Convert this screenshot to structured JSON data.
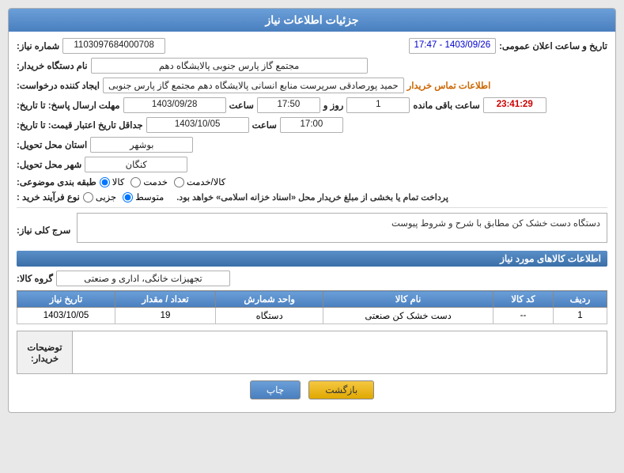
{
  "header": {
    "title": "جزئیات اطلاعات نیاز"
  },
  "fields": {
    "shomare_niaz_label": "شماره نیاز:",
    "shomare_niaz_value": "1103097684000708",
    "tarikh_label": "تاریخ و ساعت اعلان عمومی:",
    "tarikh_value": "1403/09/26 - 17:47",
    "nam_dastgah_label": "نام دستگاه خریدار:",
    "nam_dastgah_value": "مجتمع گاز پارس جنوبی  پالایشگاه دهم",
    "ijad_konande_label": "ایجاد کننده درخواست:",
    "ijad_konande_value": "حمید پورصادقی سرپرست منابع انسانی پالایشگاه دهم  مجتمع گاز پارس جنوبی",
    "ijad_konande_link": "اطلاعات تماس خریدار",
    "mohlat_ersal_label": "مهلت ارسال پاسخ: تا تاریخ:",
    "mohlat_date_value": "1403/09/28",
    "mohlat_saat_label": "ساعت",
    "mohlat_saat_value": "17:50",
    "mohlat_roz_label": "روز و",
    "mohlat_roz_value": "1",
    "mohlat_baqi_label": "ساعت باقی مانده",
    "mohlat_baqi_value": "23:41:29",
    "jadaval_label": "جداقل تاریخ اعتبار قیمت: تا تاریخ:",
    "jadaval_date_value": "1403/10/05",
    "jadaval_saat_label": "ساعت",
    "jadaval_saat_value": "17:00",
    "ostan_label": "استان محل تحویل:",
    "ostan_value": "بوشهر",
    "shahr_label": "شهر محل تحویل:",
    "shahr_value": "کنگان",
    "tabaqe_label": "طبقه بندی موضوعی:",
    "tabaqe_options": [
      "کالا",
      "خدمت",
      "کالا/خدمت"
    ],
    "tabaqe_selected": "کالا",
    "novEfarayand_label": "نوع فرآیند خرید :",
    "novEfarayand_options": [
      "جزیی",
      "متوسط"
    ],
    "novEfarayand_selected": "متوسط",
    "novEfarayand_note": "پرداخت تمام یا بخشی از مبلغ خریدار محل «اسناد خزانه اسلامی» خواهد بود.",
    "sarj_label": "سرج کلی نیاز:",
    "sarj_value": "دستگاه دست خشک کن مطابق با شرح و شروط پیوست",
    "kalahat_title": "اطلاعات کالاهای مورد نیاز",
    "grohe_label": "گروه کالا:",
    "grohe_value": "تجهیزات خانگی، اداری و صنعتی",
    "table": {
      "headers": [
        "ردیف",
        "کد کالا",
        "نام کالا",
        "واحد شمارش",
        "تعداد / مقدار",
        "تاریخ نیاز"
      ],
      "rows": [
        {
          "radif": "1",
          "kod_kala": "--",
          "nam_kala": "دست خشک کن صنعتی",
          "vahed": "دستگاه",
          "tedad": "19",
          "tarikh": "1403/10/05"
        }
      ]
    },
    "tozih_label": "توضیحات خریدار:",
    "tozih_value": "",
    "btn_print": "چاپ",
    "btn_back": "بازگشت"
  }
}
